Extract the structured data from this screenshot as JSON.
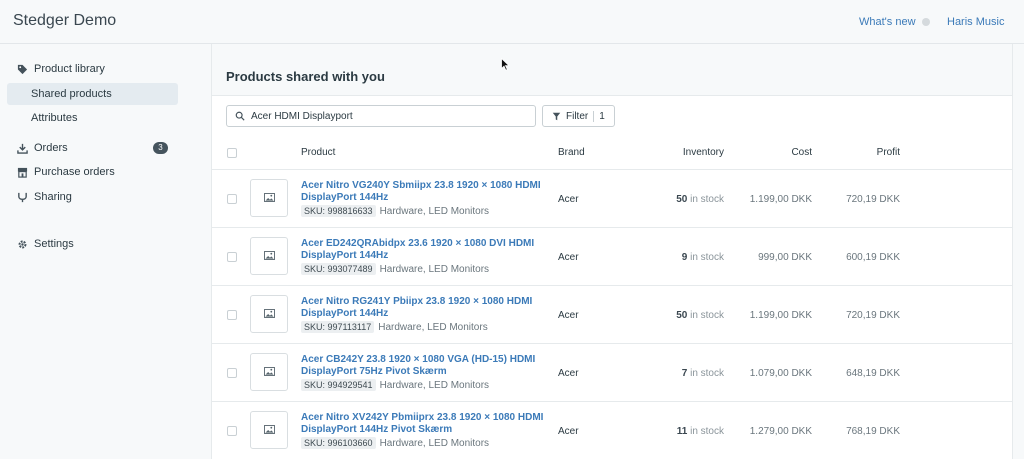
{
  "app": {
    "title": "Stedger Demo"
  },
  "topbar": {
    "whats_new": "What's new",
    "user": "Haris Music"
  },
  "sidebar": {
    "items": [
      {
        "label": "Product library",
        "icon": "tag-icon"
      },
      {
        "label": "Shared products",
        "active": true
      },
      {
        "label": "Attributes"
      },
      {
        "label": "Orders",
        "icon": "download-icon",
        "badge": "3"
      },
      {
        "label": "Purchase orders",
        "icon": "store-icon"
      },
      {
        "label": "Sharing",
        "icon": "share-icon"
      },
      {
        "label": "Settings",
        "icon": "gear-icon"
      }
    ]
  },
  "main": {
    "title": "Products shared with you",
    "search": {
      "value": "Acer HDMI Displayport"
    },
    "filter": {
      "label": "Filter",
      "count": "1"
    },
    "columns": [
      "Product",
      "Brand",
      "Inventory",
      "Cost",
      "Profit"
    ],
    "rows": [
      {
        "name": "Acer Nitro VG240Y Sbmiipx 23.8 1920 × 1080 HDMI DisplayPort 144Hz",
        "sku": "SKU: 998816633",
        "category": "Hardware, LED Monitors",
        "brand": "Acer",
        "inventory": "50",
        "inventory_unit": " in stock",
        "cost": "1.199,00 DKK",
        "profit": "720,19 DKK"
      },
      {
        "name": "Acer ED242QRAbidpx 23.6 1920 × 1080 DVI HDMI DisplayPort 144Hz",
        "sku": "SKU: 993077489",
        "category": "Hardware, LED Monitors",
        "brand": "Acer",
        "inventory": "9",
        "inventory_unit": " in stock",
        "cost": "999,00 DKK",
        "profit": "600,19 DKK"
      },
      {
        "name": "Acer Nitro RG241Y Pbiipx 23.8 1920 × 1080 HDMI DisplayPort 144Hz",
        "sku": "SKU: 997113117",
        "category": "Hardware, LED Monitors",
        "brand": "Acer",
        "inventory": "50",
        "inventory_unit": " in stock",
        "cost": "1.199,00 DKK",
        "profit": "720,19 DKK"
      },
      {
        "name": "Acer CB242Y 23.8 1920 × 1080 VGA (HD-15) HDMI DisplayPort 75Hz Pivot Skærm",
        "sku": "SKU: 994929541",
        "category": "Hardware, LED Monitors",
        "brand": "Acer",
        "inventory": "7",
        "inventory_unit": " in stock",
        "cost": "1.079,00 DKK",
        "profit": "648,19 DKK"
      },
      {
        "name": "Acer Nitro XV242Y Pbmiiprx 23.8 1920 × 1080 HDMI DisplayPort 144Hz Pivot Skærm",
        "sku": "SKU: 996103660",
        "category": "Hardware, LED Monitors",
        "brand": "Acer",
        "inventory": "11",
        "inventory_unit": " in stock",
        "cost": "1.279,00 DKK",
        "profit": "768,19 DKK"
      }
    ]
  },
  "colors": {
    "link": "#3b7ab8",
    "active_bg": "#e4ebf0",
    "badge_bg": "#45545d"
  }
}
